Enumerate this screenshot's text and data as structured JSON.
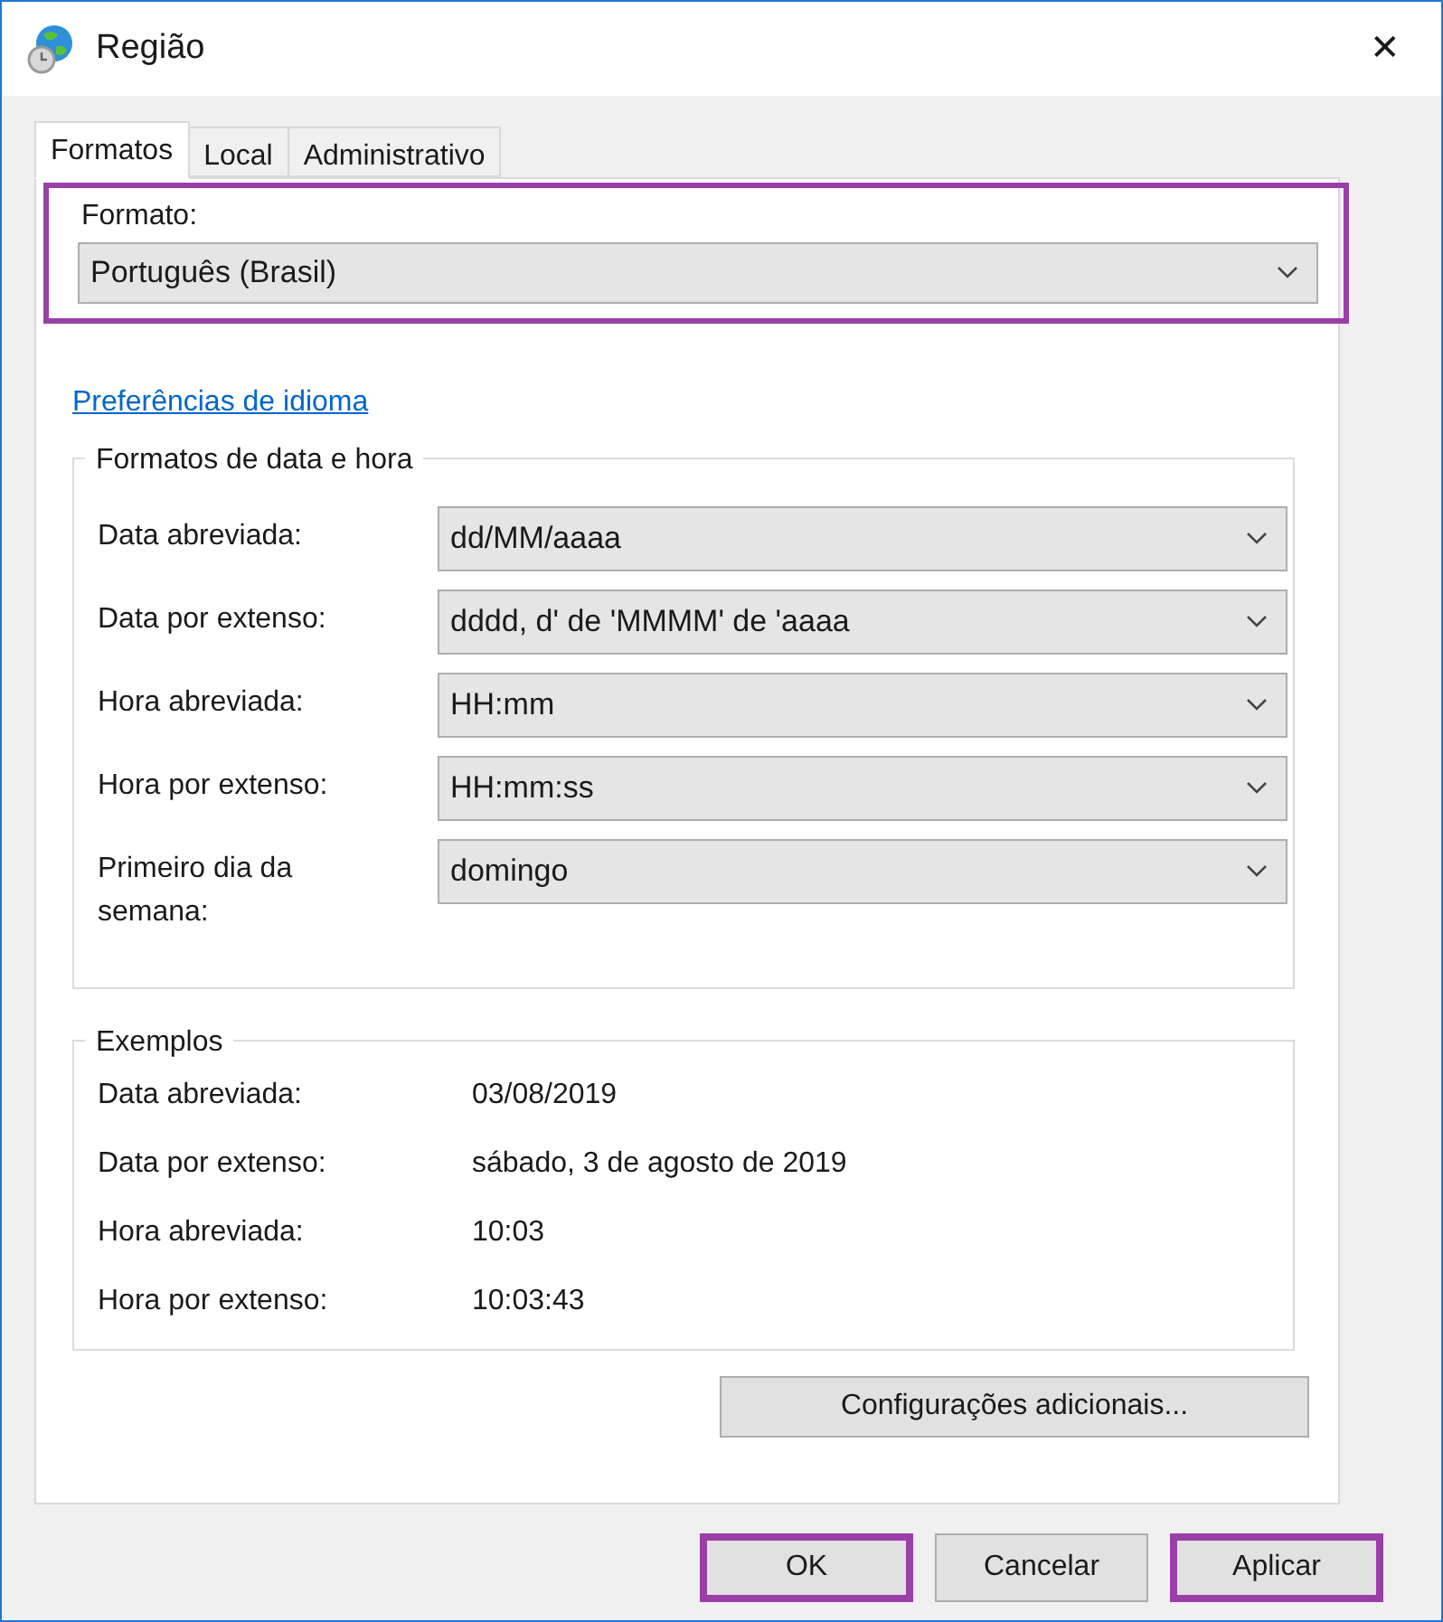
{
  "window": {
    "title": "Região",
    "close": "✕"
  },
  "tabs": [
    {
      "label": "Formatos",
      "selected": true
    },
    {
      "label": "Local",
      "selected": false
    },
    {
      "label": "Administrativo",
      "selected": false
    }
  ],
  "format": {
    "label": "Formato:",
    "value": "Português (Brasil)",
    "highlighted": true
  },
  "language_link": "Preferências de idioma",
  "date_time_group": {
    "title": "Formatos de data e hora",
    "rows": [
      {
        "label": "Data abreviada:",
        "value": "dd/MM/aaaa"
      },
      {
        "label": "Data por extenso:",
        "value": "dddd, d' de 'MMMM' de 'aaaa"
      },
      {
        "label": "Hora abreviada:",
        "value": "HH:mm"
      },
      {
        "label": "Hora por extenso:",
        "value": "HH:mm:ss"
      },
      {
        "label": "Primeiro dia da semana:",
        "value": "domingo"
      }
    ]
  },
  "examples_group": {
    "title": "Exemplos",
    "rows": [
      {
        "label": "Data abreviada:",
        "value": "03/08/2019"
      },
      {
        "label": "Data por extenso:",
        "value": "sábado, 3 de agosto de 2019"
      },
      {
        "label": "Hora abreviada:",
        "value": "10:03"
      },
      {
        "label": "Hora por extenso:",
        "value": "10:03:43"
      }
    ]
  },
  "additional_button": "Configurações adicionais...",
  "buttons": [
    {
      "label": "OK",
      "highlighted": true
    },
    {
      "label": "Cancelar",
      "highlighted": false
    },
    {
      "label": "Aplicar",
      "highlighted": true
    }
  ]
}
